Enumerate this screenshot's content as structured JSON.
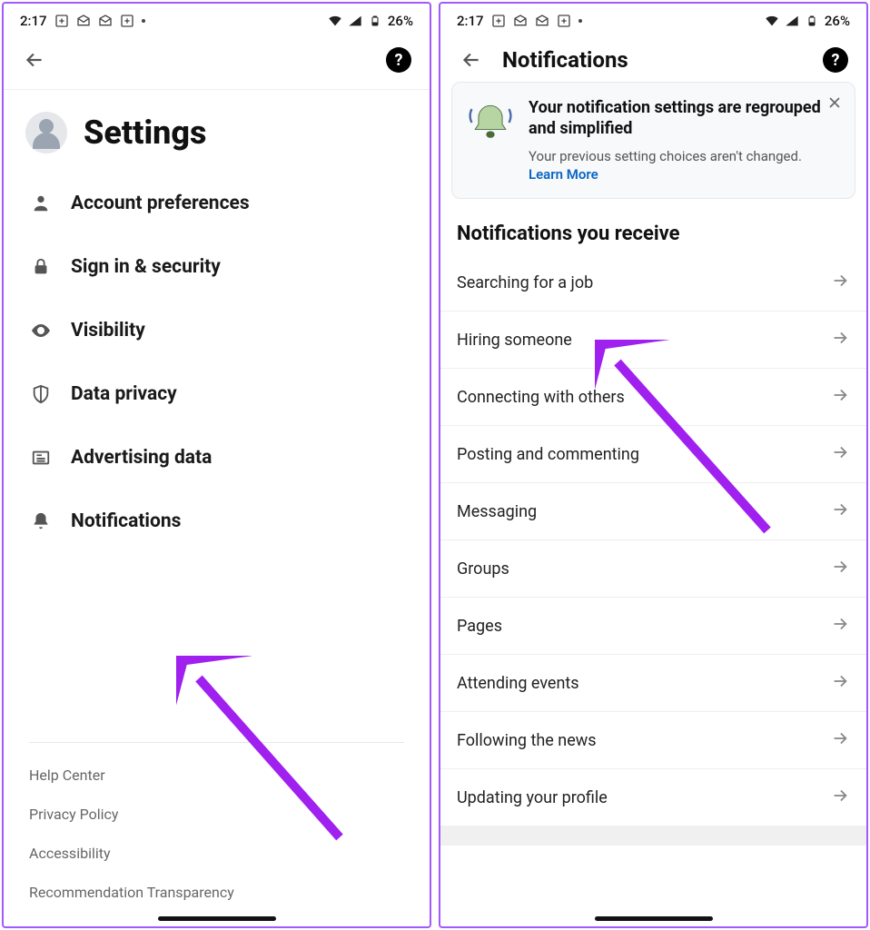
{
  "status": {
    "time": "2:17",
    "battery": "26%"
  },
  "screen1": {
    "title": "Settings",
    "menu": [
      {
        "id": "account-preferences",
        "label": "Account preferences",
        "icon": "person"
      },
      {
        "id": "signin-security",
        "label": "Sign in & security",
        "icon": "lock"
      },
      {
        "id": "visibility",
        "label": "Visibility",
        "icon": "eye"
      },
      {
        "id": "data-privacy",
        "label": "Data privacy",
        "icon": "shield"
      },
      {
        "id": "advertising-data",
        "label": "Advertising data",
        "icon": "news"
      },
      {
        "id": "notifications",
        "label": "Notifications",
        "icon": "bell"
      }
    ],
    "footer": [
      {
        "id": "help-center",
        "label": "Help Center"
      },
      {
        "id": "privacy-policy",
        "label": "Privacy Policy"
      },
      {
        "id": "accessibility",
        "label": "Accessibility"
      },
      {
        "id": "recommendation-transparency",
        "label": "Recommendation Transparency"
      }
    ]
  },
  "screen2": {
    "title": "Notifications",
    "banner": {
      "title": "Your notification settings are regrouped and simplified",
      "subtitle": "Your previous setting choices aren't changed.",
      "link": "Learn More"
    },
    "section_heading": "Notifications you receive",
    "items": [
      {
        "id": "searching-job",
        "label": "Searching for a job"
      },
      {
        "id": "hiring",
        "label": "Hiring someone"
      },
      {
        "id": "connecting",
        "label": "Connecting with others"
      },
      {
        "id": "posting",
        "label": "Posting and commenting"
      },
      {
        "id": "messaging",
        "label": "Messaging"
      },
      {
        "id": "groups",
        "label": "Groups"
      },
      {
        "id": "pages",
        "label": "Pages"
      },
      {
        "id": "events",
        "label": "Attending events"
      },
      {
        "id": "news",
        "label": "Following the news"
      },
      {
        "id": "profile",
        "label": "Updating your profile"
      }
    ]
  }
}
